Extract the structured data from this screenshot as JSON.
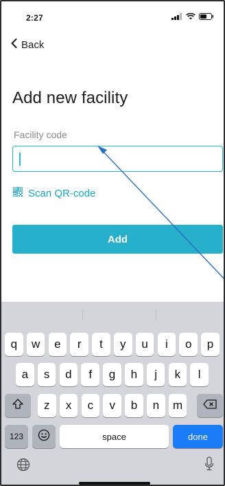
{
  "status_bar": {
    "time": "2:27"
  },
  "nav": {
    "back_label": "Back"
  },
  "page": {
    "title": "Add new facility"
  },
  "form": {
    "facility_code_label": "Facility code",
    "facility_code_value": "",
    "scan_label": "Scan QR-code",
    "add_label": "Add"
  },
  "colors": {
    "accent": "#26b0cb",
    "done_key": "#1a7cf6",
    "keyboard_bg": "#d3d5da"
  },
  "keyboard": {
    "row1": [
      "q",
      "w",
      "e",
      "r",
      "t",
      "y",
      "u",
      "i",
      "o",
      "p"
    ],
    "row2": [
      "a",
      "s",
      "d",
      "f",
      "g",
      "h",
      "j",
      "k",
      "l"
    ],
    "row3": [
      "z",
      "x",
      "c",
      "v",
      "b",
      "n",
      "m"
    ],
    "numbers_label": "123",
    "space_label": "space",
    "done_label": "done",
    "icons": [
      "shift-icon",
      "backspace-icon",
      "emoji-icon",
      "globe-icon",
      "microphone-icon"
    ]
  }
}
